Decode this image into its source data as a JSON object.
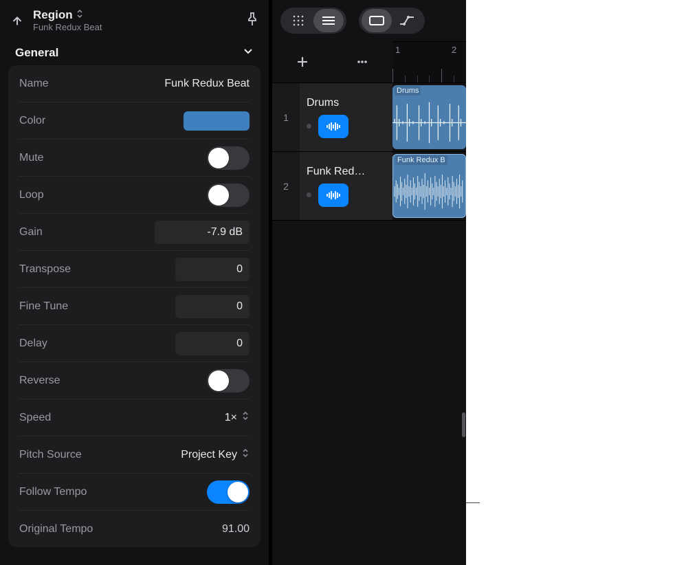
{
  "header": {
    "title": "Region",
    "subtitle": "Funk Redux Beat"
  },
  "section": {
    "title": "General"
  },
  "props": {
    "name": {
      "label": "Name",
      "value": "Funk Redux Beat"
    },
    "color": {
      "label": "Color",
      "hex": "#3d7fbf"
    },
    "mute": {
      "label": "Mute",
      "on": false
    },
    "loop": {
      "label": "Loop",
      "on": false
    },
    "gain": {
      "label": "Gain",
      "value": "-7.9 dB"
    },
    "transpose": {
      "label": "Transpose",
      "value": "0"
    },
    "finetune": {
      "label": "Fine Tune",
      "value": "0"
    },
    "delay": {
      "label": "Delay",
      "value": "0"
    },
    "reverse": {
      "label": "Reverse",
      "on": false
    },
    "speed": {
      "label": "Speed",
      "value": "1×"
    },
    "pitchsource": {
      "label": "Pitch Source",
      "value": "Project Key"
    },
    "followtempo": {
      "label": "Follow Tempo",
      "on": true
    },
    "origtempo": {
      "label": "Original Tempo",
      "value": "91.00"
    }
  },
  "ruler": {
    "marks": [
      "1",
      "2"
    ]
  },
  "tracks": [
    {
      "num": "1",
      "name": "Drums",
      "region_label": "Drums",
      "selected": false
    },
    {
      "num": "2",
      "name": "Funk Red…",
      "region_label": "Funk Redux B",
      "selected": true
    }
  ]
}
